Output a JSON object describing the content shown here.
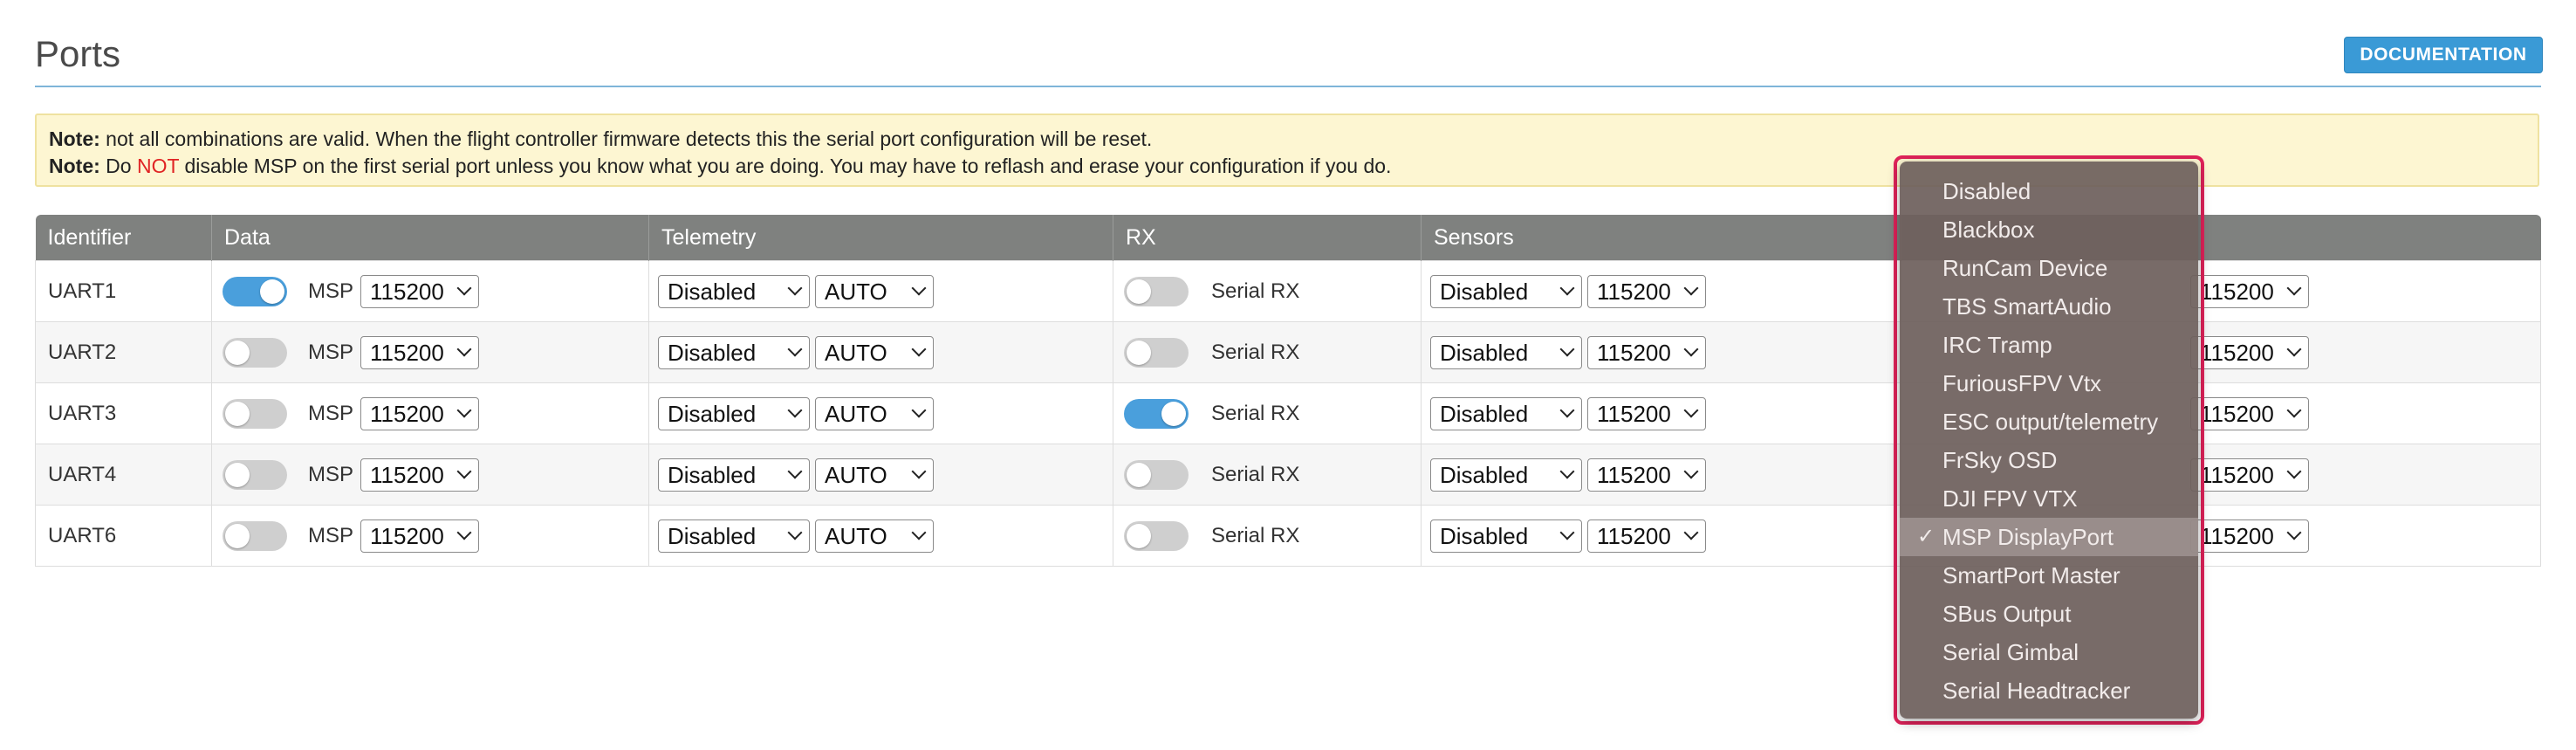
{
  "page": {
    "title": "Ports",
    "documentation_button": "DOCUMENTATION"
  },
  "note": {
    "line1_label": "Note:",
    "line1_text": "not all combinations are valid. When the flight controller firmware detects this the serial port configuration will be reset.",
    "line2_label": "Note:",
    "line2_pre": "Do",
    "line2_emph": "NOT",
    "line2_post": "disable MSP on the first serial port unless you know what you are doing. You may have to reflash and erase your configuration if you do."
  },
  "table": {
    "headers": [
      "Identifier",
      "Data",
      "Telemetry",
      "RX",
      "Sensors",
      ""
    ],
    "rows": [
      {
        "id": "UART1",
        "msp_on": true,
        "msp_label": "MSP",
        "msp_baud": "115200",
        "tel_func": "Disabled",
        "tel_baud": "AUTO",
        "rx_on": false,
        "rx_label": "Serial RX",
        "sens_func": "Disabled",
        "sens_baud": "115200",
        "per_baud": "115200"
      },
      {
        "id": "UART2",
        "msp_on": false,
        "msp_label": "MSP",
        "msp_baud": "115200",
        "tel_func": "Disabled",
        "tel_baud": "AUTO",
        "rx_on": false,
        "rx_label": "Serial RX",
        "sens_func": "Disabled",
        "sens_baud": "115200",
        "per_baud": "115200"
      },
      {
        "id": "UART3",
        "msp_on": false,
        "msp_label": "MSP",
        "msp_baud": "115200",
        "tel_func": "Disabled",
        "tel_baud": "AUTO",
        "rx_on": true,
        "rx_label": "Serial RX",
        "sens_func": "Disabled",
        "sens_baud": "115200",
        "per_baud": "115200"
      },
      {
        "id": "UART4",
        "msp_on": false,
        "msp_label": "MSP",
        "msp_baud": "115200",
        "tel_func": "Disabled",
        "tel_baud": "AUTO",
        "rx_on": false,
        "rx_label": "Serial RX",
        "sens_func": "Disabled",
        "sens_baud": "115200",
        "per_baud": "115200"
      },
      {
        "id": "UART6",
        "msp_on": false,
        "msp_label": "MSP",
        "msp_baud": "115200",
        "tel_func": "Disabled",
        "tel_baud": "AUTO",
        "rx_on": false,
        "rx_label": "Serial RX",
        "sens_func": "Disabled",
        "sens_baud": "115200",
        "per_baud": "115200"
      }
    ]
  },
  "dropdown": {
    "options": [
      "Disabled",
      "Blackbox",
      "RunCam Device",
      "TBS SmartAudio",
      "IRC Tramp",
      "FuriousFPV Vtx",
      "ESC output/telemetry",
      "FrSky OSD",
      "DJI FPV VTX",
      "MSP DisplayPort",
      "SmartPort Master",
      "SBus Output",
      "Serial Gimbal",
      "Serial Headtracker"
    ],
    "selected": "MSP DisplayPort",
    "check_glyph": "✓"
  },
  "colors": {
    "accent": "#3a9ad6",
    "toggle_on": "#4a9fdc",
    "header_bg": "#7f817f",
    "note_bg": "#fdf6d2",
    "highlight_outline": "#e0225a"
  }
}
